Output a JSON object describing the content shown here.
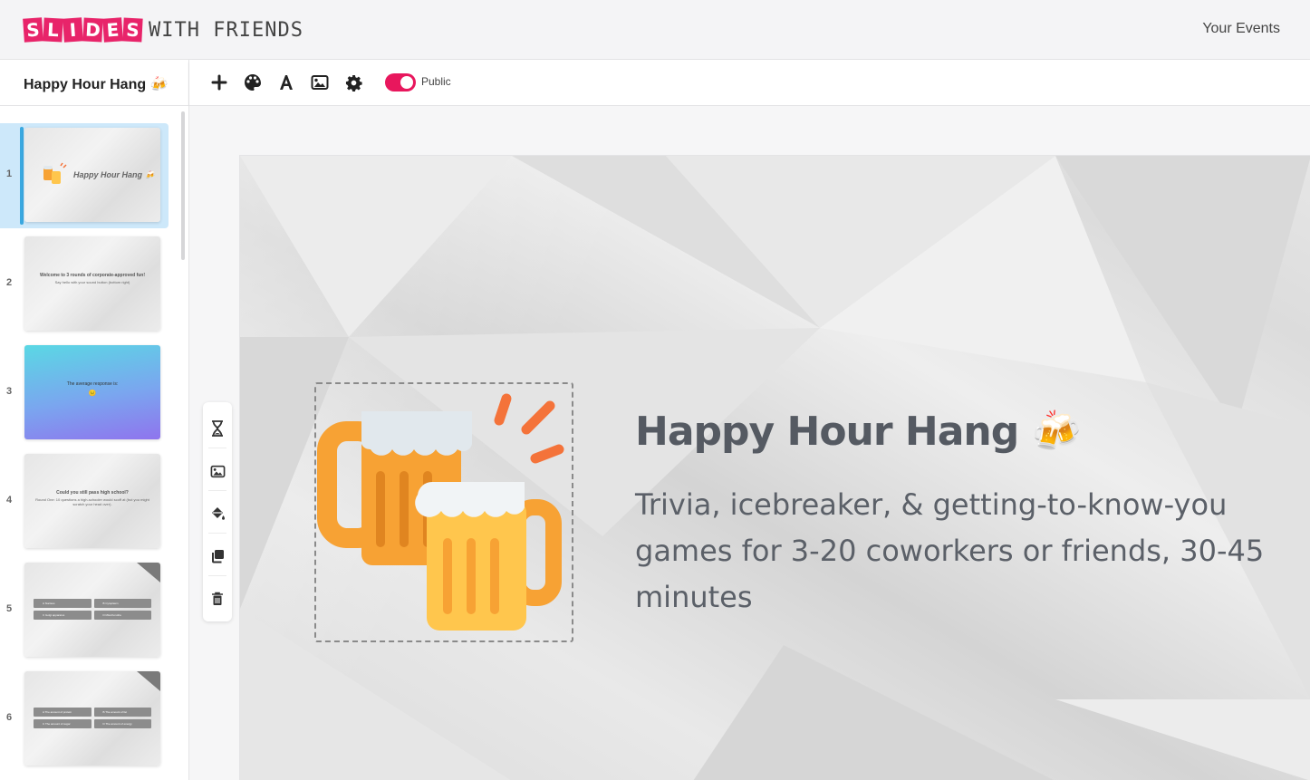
{
  "app": {
    "logo_boxed": [
      "S",
      "L",
      "I",
      "D",
      "E",
      "S"
    ],
    "logo_rest": "WITH FRIENDS",
    "nav_your_events": "Your Events"
  },
  "deck": {
    "title": "Happy Hour Hang 🍻",
    "visibility_label": "Public",
    "visibility_public": true
  },
  "toolbar": {
    "icons": [
      "plus-icon",
      "palette-icon",
      "text-font-icon",
      "image-icon",
      "gear-icon",
      "toggle-switch"
    ]
  },
  "side_tools": {
    "icons": [
      "hourglass-icon",
      "image-icon",
      "paint-bucket-icon",
      "duplicate-icon",
      "trash-icon"
    ]
  },
  "slides": [
    {
      "number": "1",
      "title": "Happy Hour Hang 🍻",
      "active": true
    },
    {
      "number": "2",
      "title": "Welcome to 3 rounds of corporate-approved fun!",
      "subtitle": "Say hello with your sound button (bottom right)"
    },
    {
      "number": "3",
      "title": "The average response is:",
      "subtitle": "😐"
    },
    {
      "number": "4",
      "title": "Could you still pass high school?",
      "subtitle": "Round One: 10 questions a high-schooler would scoff at (but you might scratch your head over)."
    },
    {
      "number": "5",
      "answers": [
        {
          "letter": "A",
          "text": "Nucleus"
        },
        {
          "letter": "B",
          "text": "Cytoplasm"
        },
        {
          "letter": "C",
          "text": "Golgi apparatus"
        },
        {
          "letter": "D",
          "text": "Mitochondria"
        }
      ]
    },
    {
      "number": "6",
      "answers": [
        {
          "letter": "A",
          "text": "The amount of protein"
        },
        {
          "letter": "B",
          "text": "The amount of fat"
        },
        {
          "letter": "C",
          "text": "The amount of sugar"
        },
        {
          "letter": "D",
          "text": "The amount of energy"
        }
      ]
    }
  ],
  "main_slide": {
    "title": "Happy Hour Hang 🍻",
    "body": "Trivia, icebreaker, & getting-to-know-you games for 3-20 coworkers or friends, 30-45 minutes",
    "image": "beer-mugs-clinking-icon"
  },
  "colors": {
    "brand_pink": "#e8246a",
    "active_blue": "#3aa8e0",
    "active_bg": "#cde8fa",
    "toggle_on": "#e8175d"
  }
}
